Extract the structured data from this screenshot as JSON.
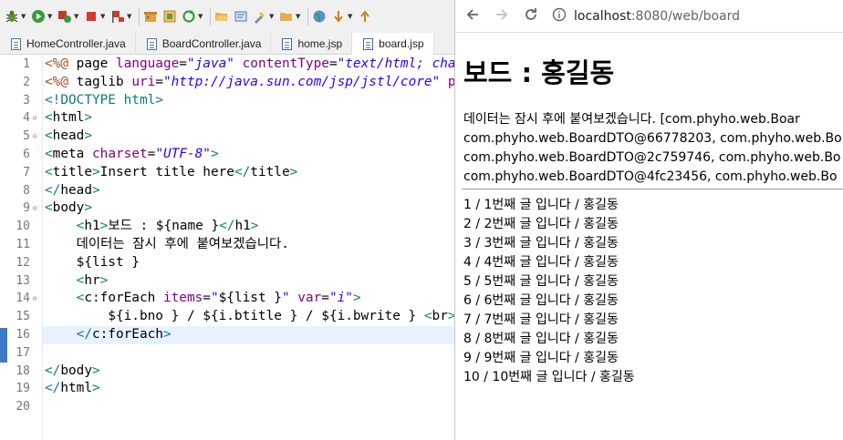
{
  "ide": {
    "tabs": [
      {
        "label": "HomeController.java",
        "type": "java"
      },
      {
        "label": "BoardController.java",
        "type": "java"
      },
      {
        "label": "home.jsp",
        "type": "jsp"
      },
      {
        "label": "board.jsp",
        "type": "jsp",
        "active": true
      }
    ],
    "highlighted_line": 16,
    "code_lines": [
      {
        "n": "1",
        "spans": [
          [
            "c-dir",
            "<%@ "
          ],
          [
            "c-el",
            "page "
          ],
          [
            "c-attr",
            "language"
          ],
          [
            "c-plain",
            "="
          ],
          [
            "c-val",
            "\"java\""
          ],
          [
            "c-plain",
            " "
          ],
          [
            "c-attr",
            "contentType"
          ],
          [
            "c-plain",
            "="
          ],
          [
            "c-val",
            "\"text/html; charset"
          ]
        ]
      },
      {
        "n": "2",
        "spans": [
          [
            "c-dir",
            "<%@ "
          ],
          [
            "c-el",
            "taglib "
          ],
          [
            "c-attr",
            "uri"
          ],
          [
            "c-plain",
            "="
          ],
          [
            "c-val",
            "\"http://java.sun.com/jsp/jstl/core\""
          ],
          [
            "c-plain",
            " "
          ],
          [
            "c-attr",
            "prefi"
          ]
        ]
      },
      {
        "n": "3",
        "spans": [
          [
            "c-tag",
            "<!DOCTYPE html>"
          ]
        ]
      },
      {
        "n": "4",
        "fold": true,
        "spans": [
          [
            "c-tag",
            "<"
          ],
          [
            "c-el",
            "html"
          ],
          [
            "c-tag",
            ">"
          ]
        ]
      },
      {
        "n": "5",
        "fold": true,
        "spans": [
          [
            "c-tag",
            "<"
          ],
          [
            "c-el",
            "head"
          ],
          [
            "c-tag",
            ">"
          ]
        ]
      },
      {
        "n": "6",
        "spans": [
          [
            "c-tag",
            "<"
          ],
          [
            "c-el",
            "meta "
          ],
          [
            "c-attr",
            "charset"
          ],
          [
            "c-plain",
            "="
          ],
          [
            "c-val",
            "\"UTF-8\""
          ],
          [
            "c-tag",
            ">"
          ]
        ]
      },
      {
        "n": "7",
        "spans": [
          [
            "c-tag",
            "<"
          ],
          [
            "c-el",
            "title"
          ],
          [
            "c-tag",
            ">"
          ],
          [
            "c-plain",
            "Insert title here"
          ],
          [
            "c-tag",
            "</"
          ],
          [
            "c-el",
            "title"
          ],
          [
            "c-tag",
            ">"
          ]
        ]
      },
      {
        "n": "8",
        "spans": [
          [
            "c-tag",
            "</"
          ],
          [
            "c-el",
            "head"
          ],
          [
            "c-tag",
            ">"
          ]
        ]
      },
      {
        "n": "9",
        "fold": true,
        "spans": [
          [
            "c-tag",
            "<"
          ],
          [
            "c-el",
            "body"
          ],
          [
            "c-tag",
            ">"
          ]
        ]
      },
      {
        "n": "10",
        "spans": [
          [
            "c-plain",
            "    "
          ],
          [
            "c-tag",
            "<"
          ],
          [
            "c-el",
            "h1"
          ],
          [
            "c-tag",
            ">"
          ],
          [
            "c-plain",
            "보드 : ${name }"
          ],
          [
            "c-tag",
            "</"
          ],
          [
            "c-el",
            "h1"
          ],
          [
            "c-tag",
            ">"
          ]
        ]
      },
      {
        "n": "11",
        "spans": [
          [
            "c-plain",
            "    데이터는 잠시 후에 붙여보겠습니다."
          ]
        ]
      },
      {
        "n": "12",
        "spans": [
          [
            "c-plain",
            "    ${list }"
          ]
        ]
      },
      {
        "n": "13",
        "spans": [
          [
            "c-plain",
            "    "
          ],
          [
            "c-tag",
            "<"
          ],
          [
            "c-el",
            "hr"
          ],
          [
            "c-tag",
            ">"
          ]
        ]
      },
      {
        "n": "14",
        "fold": true,
        "spans": [
          [
            "c-plain",
            "    "
          ],
          [
            "c-tag",
            "<"
          ],
          [
            "c-el",
            "c:forEach "
          ],
          [
            "c-attr",
            "items"
          ],
          [
            "c-plain",
            "="
          ],
          [
            "c-val",
            "\""
          ],
          [
            "c-plain",
            "${list }"
          ],
          [
            "c-val",
            "\""
          ],
          [
            "c-plain",
            " "
          ],
          [
            "c-attr",
            "var"
          ],
          [
            "c-plain",
            "="
          ],
          [
            "c-val",
            "\"i\""
          ],
          [
            "c-tag",
            ">"
          ]
        ]
      },
      {
        "n": "15",
        "spans": [
          [
            "c-plain",
            "        ${i.bno } / ${i.btitle } / ${i.bwrite } "
          ],
          [
            "c-tag",
            "<"
          ],
          [
            "c-el",
            "br"
          ],
          [
            "c-tag",
            ">"
          ]
        ]
      },
      {
        "n": "16",
        "spans": [
          [
            "c-plain",
            "    "
          ],
          [
            "c-tag",
            "</"
          ],
          [
            "c-el",
            "c:forEach"
          ],
          [
            "c-tag",
            ">"
          ]
        ]
      },
      {
        "n": "17",
        "spans": []
      },
      {
        "n": "18",
        "spans": [
          [
            "c-tag",
            "</"
          ],
          [
            "c-el",
            "body"
          ],
          [
            "c-tag",
            ">"
          ]
        ]
      },
      {
        "n": "19",
        "spans": [
          [
            "c-tag",
            "</"
          ],
          [
            "c-el",
            "html"
          ],
          [
            "c-tag",
            ">"
          ]
        ]
      },
      {
        "n": "20",
        "spans": []
      }
    ]
  },
  "browser": {
    "url_host": "localhost",
    "url_path": ":8080/web/board"
  },
  "page": {
    "heading": "보드 : 홍길동",
    "paragraph_lines": [
      "데이터는 잠시 후에 붙여보겠습니다. [com.phyho.web.Boar",
      "com.phyho.web.BoardDTO@66778203, com.phyho.web.Bo",
      "com.phyho.web.BoardDTO@2c759746, com.phyho.web.Bo",
      "com.phyho.web.BoardDTO@4fc23456, com.phyho.web.Bo"
    ],
    "rows": [
      "1 / 1번째 글 입니다 / 홍길동",
      "2 / 2번째 글 입니다 / 홍길동",
      "3 / 3번째 글 입니다 / 홍길동",
      "4 / 4번째 글 입니다 / 홍길동",
      "5 / 5번째 글 입니다 / 홍길동",
      "6 / 6번째 글 입니다 / 홍길동",
      "7 / 7번째 글 입니다 / 홍길동",
      "8 / 8번째 글 입니다 / 홍길동",
      "9 / 9번째 글 입니다 / 홍길동",
      "10 / 10번째 글 입니다 / 홍길동"
    ]
  }
}
